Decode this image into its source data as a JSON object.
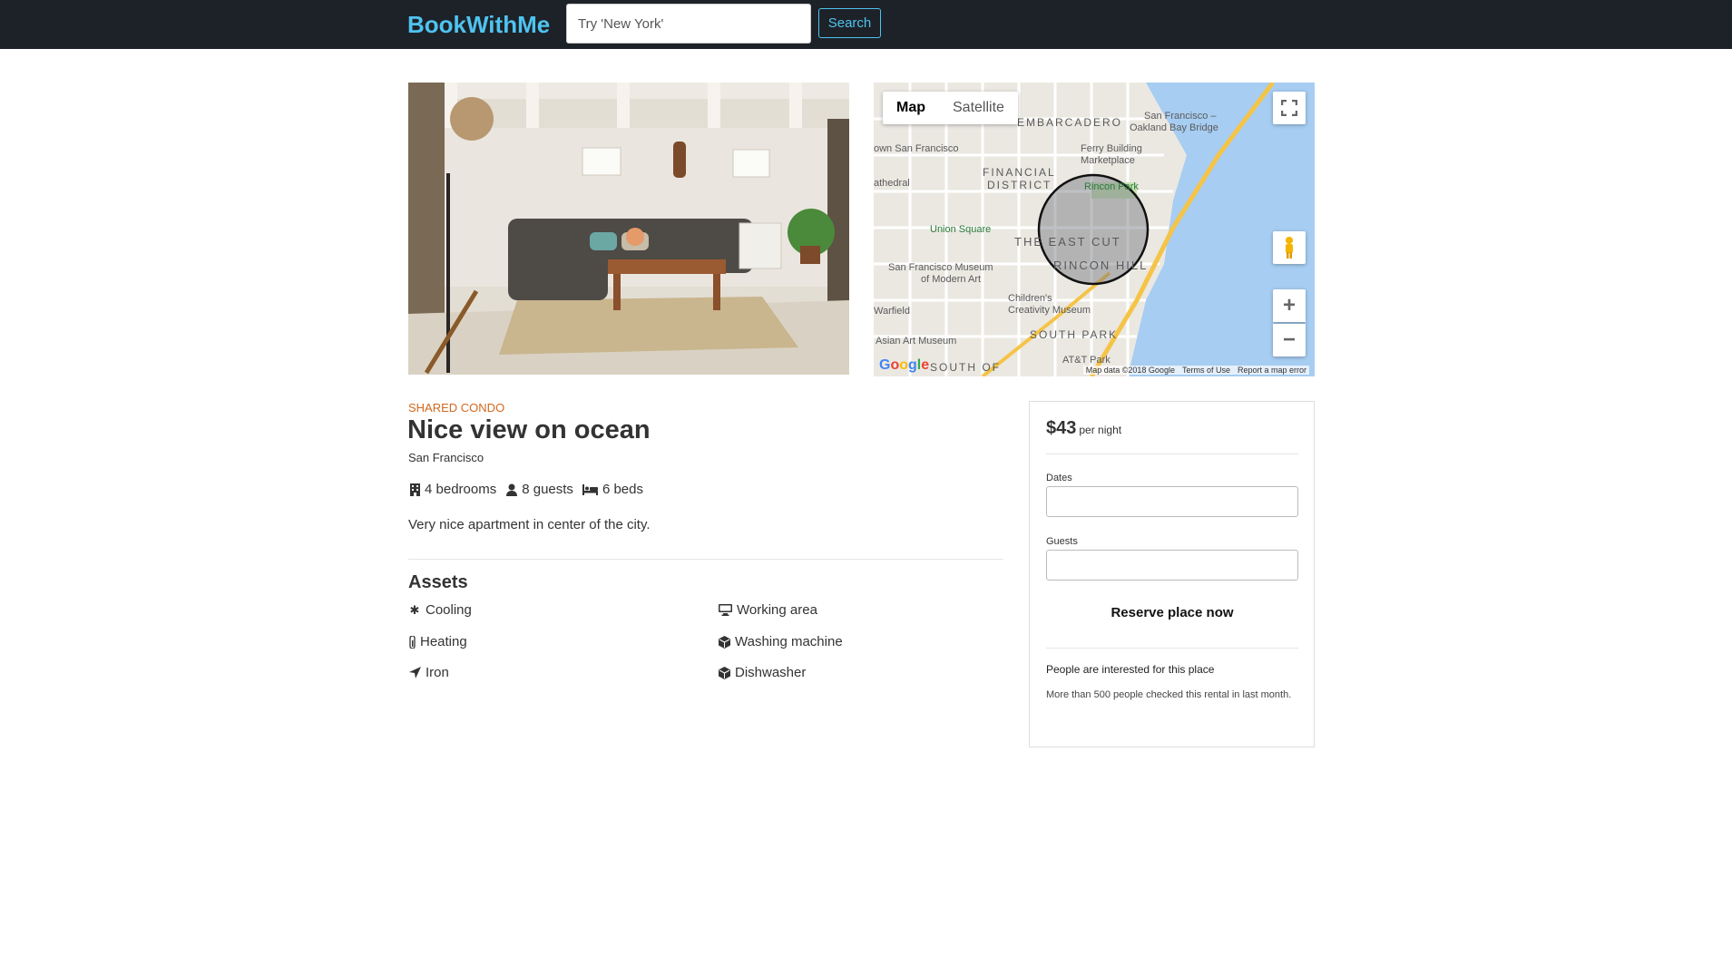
{
  "navbar": {
    "brand": "BookWithMe",
    "search_placeholder": "Try 'New York'",
    "search_button": "Search"
  },
  "map": {
    "tab_map": "Map",
    "tab_satellite": "Satellite",
    "footer_data": "Map data ©2018 Google",
    "footer_terms": "Terms of Use",
    "footer_report": "Report a map error",
    "labels": [
      "EMBARCADERO",
      "FINANCIAL DISTRICT",
      "THE EAST CUT",
      "RINCON HILL",
      "SOUTH PARK",
      "Union Square",
      "San Francisco Museum of Modern Art",
      "Children's Creativity Museum",
      "Ferry Building Marketplace",
      "Rincon Park",
      "Asian Art Museum",
      "AT&T Park",
      "San Francisco – Oakland Bay Bridge",
      "SOUTH OF MARKET"
    ]
  },
  "rental": {
    "type": "SHARED CONDO",
    "title": "Nice view on ocean",
    "city": "San Francisco",
    "bedrooms": "4 bedrooms",
    "guests": "8 guests",
    "beds": "6 beds",
    "description": "Very nice apartment in center of the city."
  },
  "assets": {
    "heading": "Assets",
    "items": [
      {
        "label": "Cooling",
        "icon": "snowflake-icon"
      },
      {
        "label": "Working area",
        "icon": "desktop-icon"
      },
      {
        "label": "Heating",
        "icon": "thermometer-icon"
      },
      {
        "label": "Washing machine",
        "icon": "cube-icon"
      },
      {
        "label": "Iron",
        "icon": "location-arrow-icon"
      },
      {
        "label": "Dishwasher",
        "icon": "cube-icon"
      }
    ]
  },
  "booking": {
    "price": "$43",
    "per_night": "per night",
    "dates_label": "Dates",
    "guests_label": "Guests",
    "reserve": "Reserve place now",
    "interest_heading": "People are interested for this place",
    "interest_text": "More than 500 people checked this rental in last month."
  },
  "colors": {
    "navbar_bg": "#1d2228",
    "brand": "#4fc3ef",
    "type_label": "#d2691e"
  }
}
